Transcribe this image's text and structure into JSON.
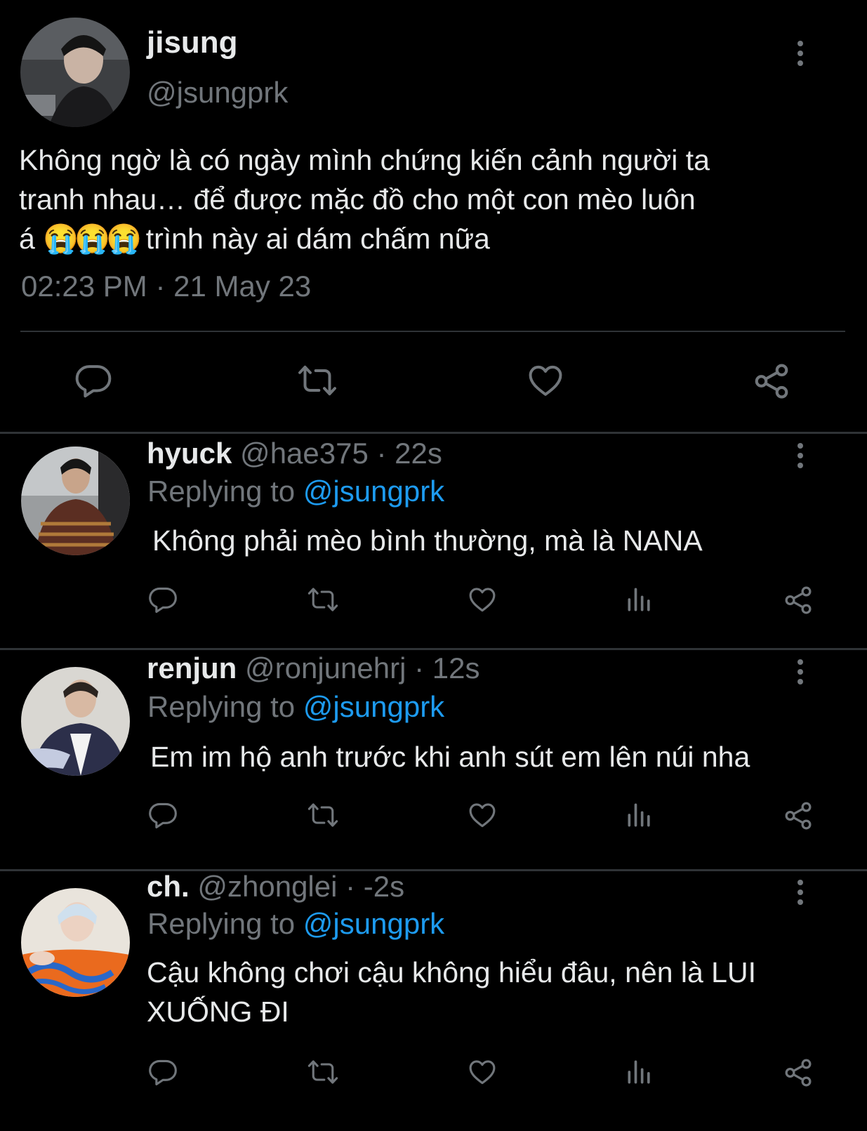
{
  "main_tweet": {
    "author_name": "jisung",
    "author_handle": "@jsungprk",
    "text_line1": "Không ngờ là có ngày mình chứng kiến cảnh người ta",
    "text_line2": "tranh nhau… để được mặc đồ cho một con mèo luôn",
    "text_line3_prefix": "á ",
    "text_line3_emoji": "😭😭😭",
    "text_line3_suffix": " trình này ai dám chấm nữa",
    "timestamp": "02:23 PM · 21 May 23",
    "actions": [
      "reply-icon",
      "retweet-icon",
      "like-icon",
      "share-icon"
    ]
  },
  "replies": [
    {
      "name": "hyuck",
      "handle_time": " @hae375 · 22s",
      "replying_prefix": "Replying to ",
      "replying_mention": "@jsungprk",
      "text": "Không phải mèo bình thường, mà là NANA",
      "actions": [
        "reply-icon",
        "retweet-icon",
        "like-icon",
        "analytics-icon",
        "share-icon"
      ]
    },
    {
      "name": "renjun",
      "handle_time": " @ronjunehrj · 12s",
      "replying_prefix": "Replying to ",
      "replying_mention": "@jsungprk",
      "text": "Em im hộ anh trước khi anh sút em lên núi nha",
      "actions": [
        "reply-icon",
        "retweet-icon",
        "like-icon",
        "analytics-icon",
        "share-icon"
      ]
    },
    {
      "name": "ch.",
      "handle_time": " @zhonglei · -2s",
      "replying_prefix": "Replying to ",
      "replying_mention": "@jsungprk",
      "text_line1": "Cậu không chơi cậu không hiểu đâu, nên là LUI",
      "text_line2": "XUỐNG ĐI",
      "actions": [
        "reply-icon",
        "retweet-icon",
        "like-icon",
        "analytics-icon",
        "share-icon"
      ]
    }
  ],
  "colors": {
    "background": "#000000",
    "text": "#e7e9ea",
    "secondary": "#71767b",
    "link": "#1d9bf0",
    "divider": "#2f3336"
  }
}
